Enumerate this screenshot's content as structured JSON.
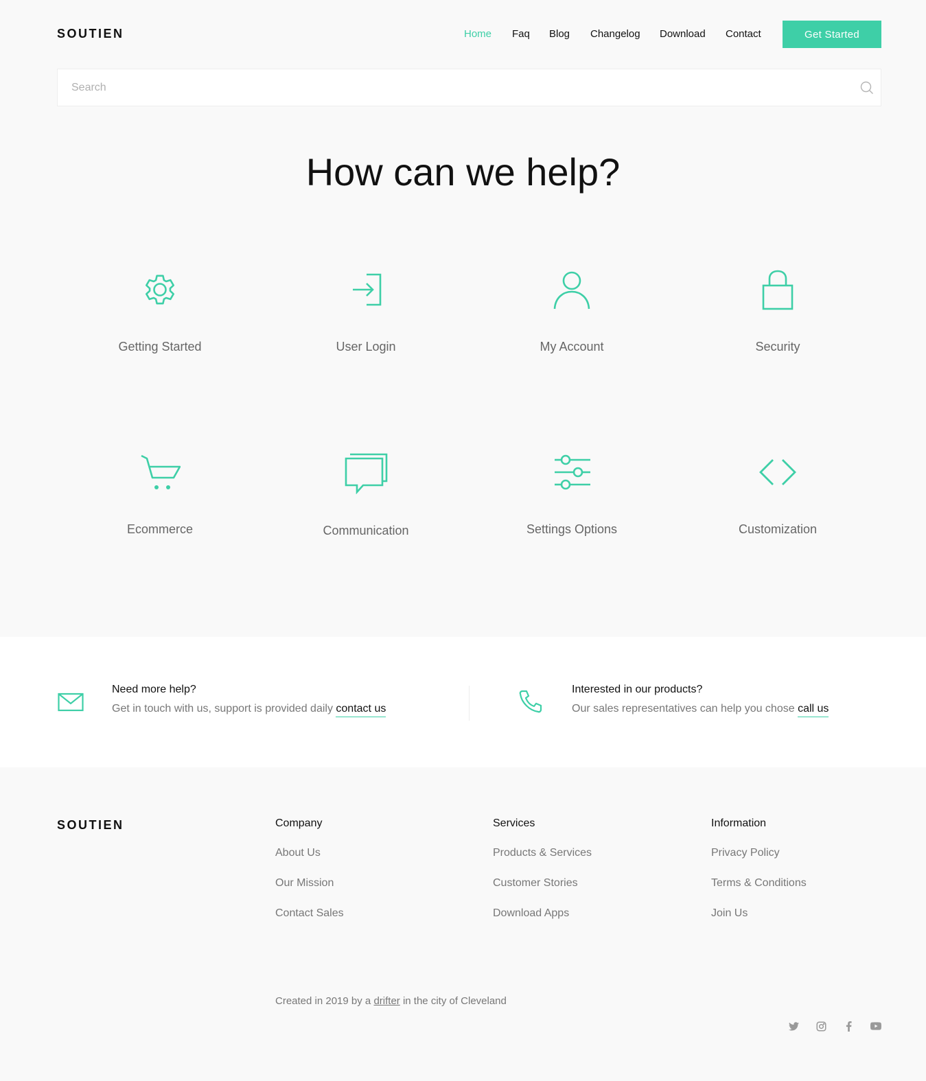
{
  "header": {
    "brand": "SOUTIEN",
    "nav": [
      "Home",
      "Faq",
      "Blog",
      "Changelog",
      "Download",
      "Contact"
    ],
    "active_nav": "Home",
    "cta_label": "Get Started"
  },
  "search": {
    "placeholder": "Search",
    "value": ""
  },
  "hero": {
    "title": "How can we help?"
  },
  "categories": [
    {
      "label": "Getting Started",
      "icon": "gear-icon"
    },
    {
      "label": "User Login",
      "icon": "login-icon"
    },
    {
      "label": "My Account",
      "icon": "user-icon"
    },
    {
      "label": "Security",
      "icon": "lock-icon"
    },
    {
      "label": "Ecommerce",
      "icon": "cart-icon"
    },
    {
      "label": "Communication",
      "icon": "chat-icon"
    },
    {
      "label": "Settings Options",
      "icon": "sliders-icon"
    },
    {
      "label": "Customization",
      "icon": "code-icon"
    }
  ],
  "help": {
    "left": {
      "title": "Need more help?",
      "desc": "Get in touch with us, support is provided daily",
      "link": "contact us",
      "icon": "mail-icon"
    },
    "right": {
      "title": "Interested in our products?",
      "desc": "Our sales representatives can help you chose",
      "link": "call us",
      "icon": "phone-icon"
    }
  },
  "footer": {
    "brand": "SOUTIEN",
    "columns": [
      {
        "heading": "Company",
        "links": [
          "About Us",
          "Our Mission",
          "Contact Sales"
        ]
      },
      {
        "heading": "Services",
        "links": [
          "Products & Services",
          "Customer Stories",
          "Download Apps"
        ]
      },
      {
        "heading": "Information",
        "links": [
          "Privacy Policy",
          "Terms & Conditions",
          "Join Us"
        ]
      }
    ],
    "credit_prefix": "Created in 2019 by a",
    "credit_link": "drifter",
    "credit_suffix": "in the city of Cleveland",
    "social": [
      "twitter-icon",
      "instagram-icon",
      "facebook-icon",
      "youtube-icon"
    ]
  },
  "colors": {
    "accent": "#3ecfa7",
    "text": "#111111",
    "muted": "#777777",
    "background": "#f9f9f9"
  }
}
